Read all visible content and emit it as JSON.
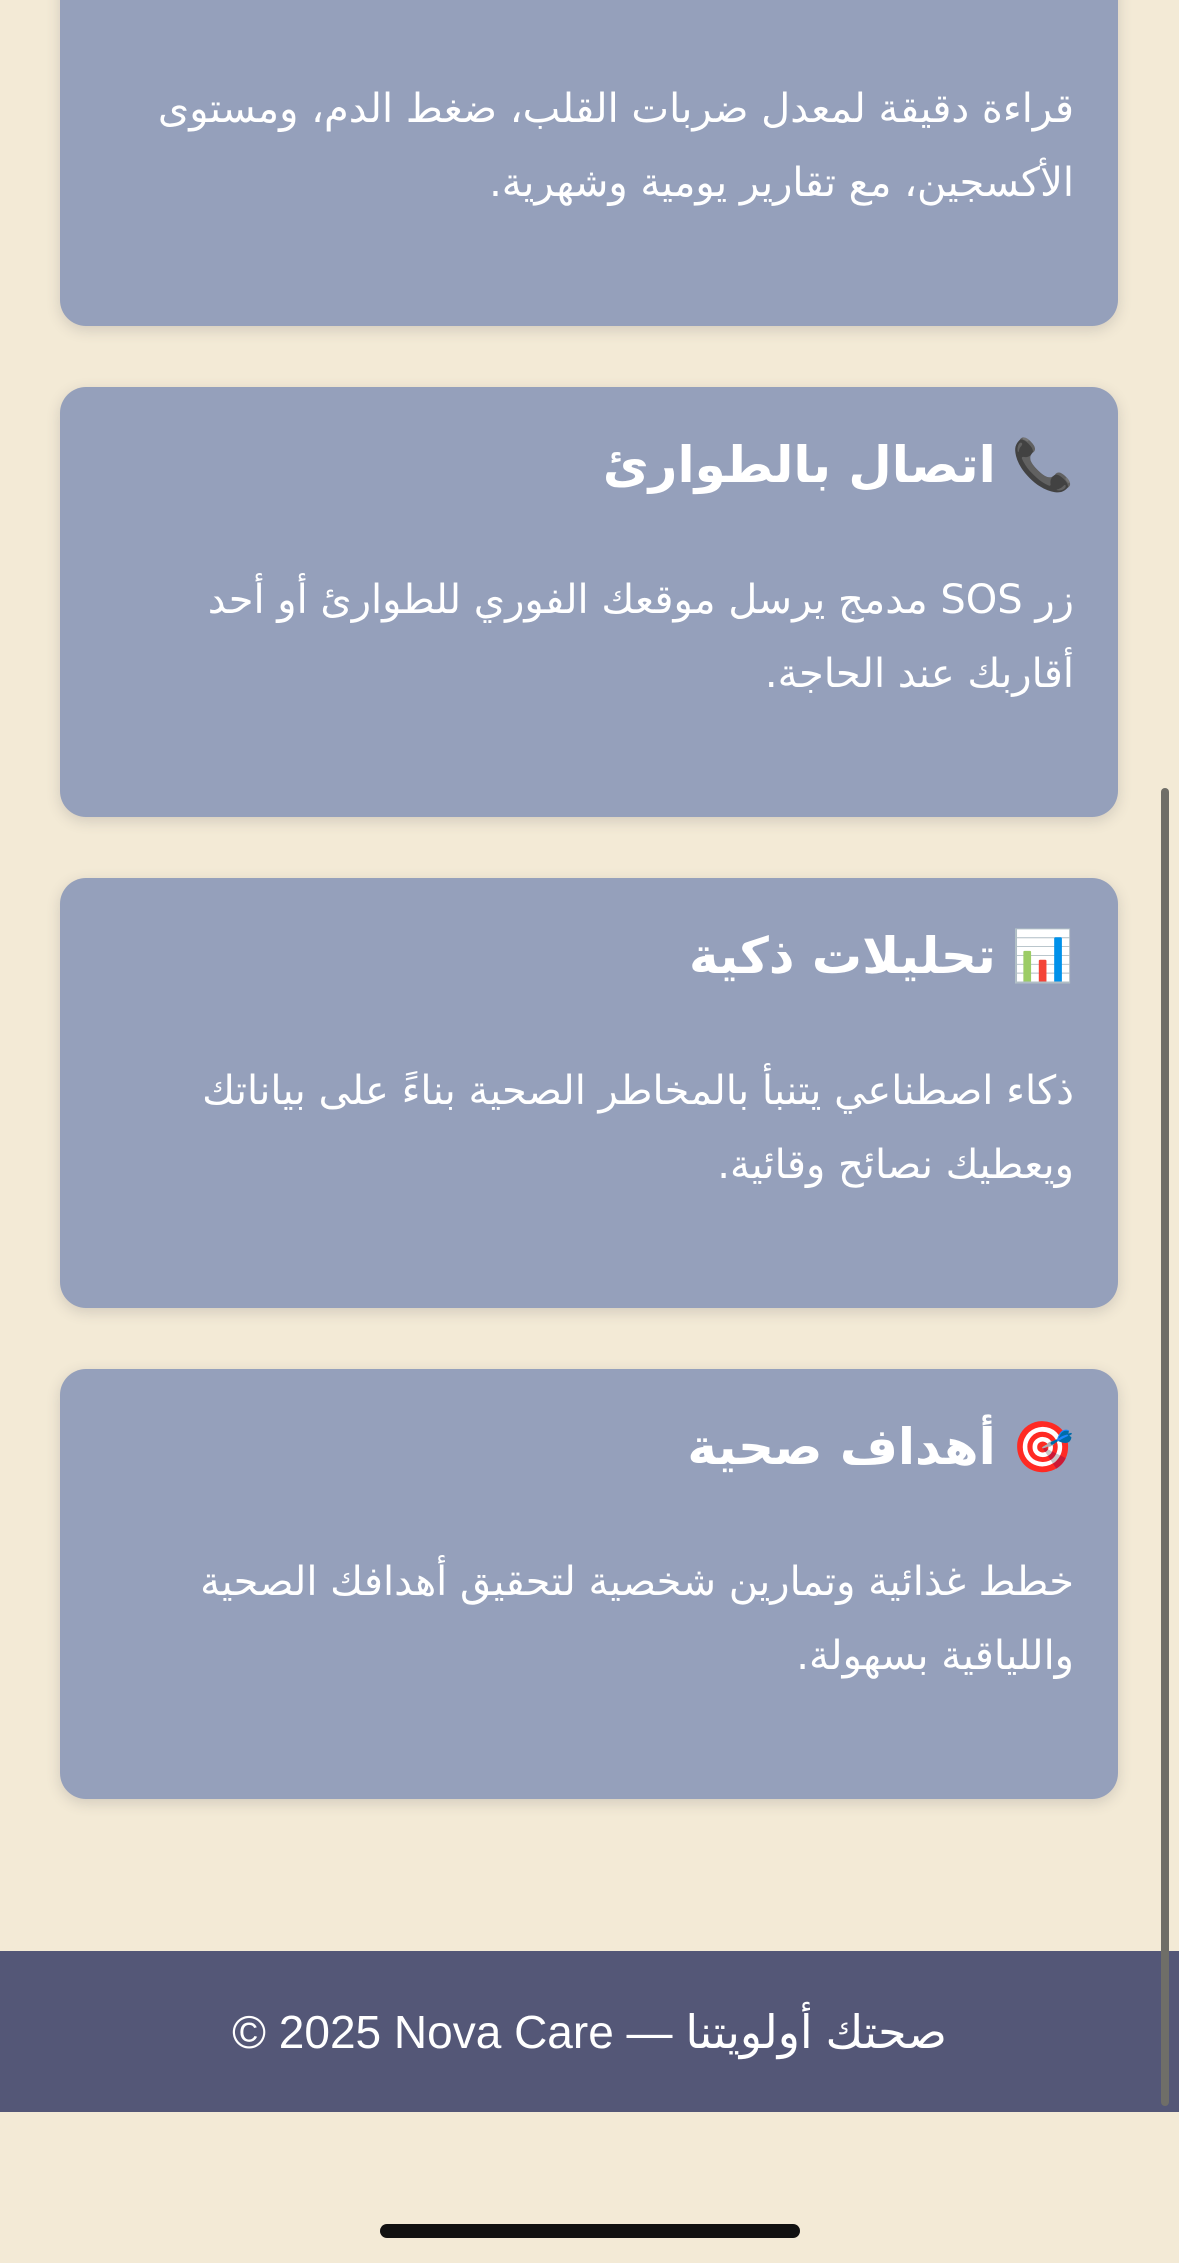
{
  "cards": [
    {
      "title": "",
      "icon": "",
      "description": "قراءة دقيقة لمعدل ضربات القلب، ضغط الدم، ومستوى الأكسجين، مع تقارير يومية وشهرية."
    },
    {
      "title": "اتصال بالطوارئ",
      "icon": "📞",
      "icon_name": "telephone-icon",
      "description": "زر SOS مدمج يرسل موقعك الفوري للطوارئ أو أحد أقاربك عند الحاجة."
    },
    {
      "title": "تحليلات ذكية",
      "icon": "📊",
      "icon_name": "bar-chart-icon",
      "description": "ذكاء اصطناعي يتنبأ بالمخاطر الصحية بناءً على بياناتك ويعطيك نصائح وقائية."
    },
    {
      "title": "أهداف صحية",
      "icon": "🎯",
      "icon_name": "target-icon",
      "description": "خطط غذائية وتمارين شخصية لتحقيق أهدافك الصحية واللياقية بسهولة."
    }
  ],
  "footer": {
    "text": "© 2025 Nova Care — صحتك أولويتنا"
  },
  "colors": {
    "page_background": "#f3ead6",
    "card_background": "#95a0bb",
    "footer_background": "#545777",
    "text": "#ffffff"
  }
}
